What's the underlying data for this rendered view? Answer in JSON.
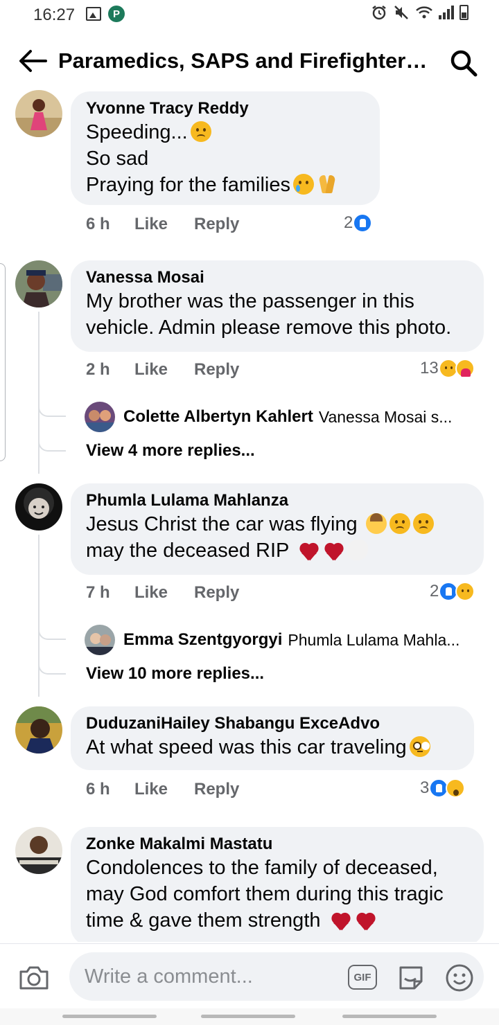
{
  "status_bar": {
    "time": "16:27"
  },
  "header": {
    "title": "Paramedics, SAPS and Firefighters..."
  },
  "comments": [
    {
      "author": "Yvonne Tracy Reddy",
      "lines": [
        "Speeding...",
        "So sad",
        "Praying for the families"
      ],
      "time": "6 h",
      "like_label": "Like",
      "reply_label": "Reply",
      "reaction_count": "2"
    },
    {
      "author": "Vanessa Mosai",
      "text": "My brother was the passenger in this\nvehicle. Admin please remove this photo.",
      "time": "2 h",
      "like_label": "Like",
      "reply_label": "Reply",
      "reaction_count": "13",
      "reply_preview": {
        "author": "Colette Albertyn Kahlert",
        "snippet": "Vanessa Mosai s..."
      },
      "view_more": "View 4 more replies..."
    },
    {
      "author": "Phumla Lulama Mahlanza",
      "line1": "Jesus Christ the car was flying",
      "line2": "may the deceased RIP",
      "time": "7 h",
      "like_label": "Like",
      "reply_label": "Reply",
      "reaction_count": "2",
      "reply_preview": {
        "author": "Emma Szentgyorgyi",
        "snippet": "Phumla Lulama Mahla..."
      },
      "view_more": "View 10 more replies..."
    },
    {
      "author": "DuduzaniHailey Shabangu ExceAdvo",
      "text": "At what speed was this car traveling",
      "time": "6 h",
      "like_label": "Like",
      "reply_label": "Reply",
      "reaction_count": "3"
    },
    {
      "author": "Zonke Makalmi Mastatu",
      "line1": "Condolences to the family of deceased,",
      "line2": "may God comfort them during this tragic",
      "line3": "time &  gave them strength"
    }
  ],
  "composer": {
    "placeholder": "Write a comment...",
    "gif_label": "GIF"
  },
  "colors": {
    "bubble": "#f0f2f5",
    "meta": "#65676b",
    "like_blue": "#1877f2",
    "sad_yellow": "#f7b91f"
  }
}
